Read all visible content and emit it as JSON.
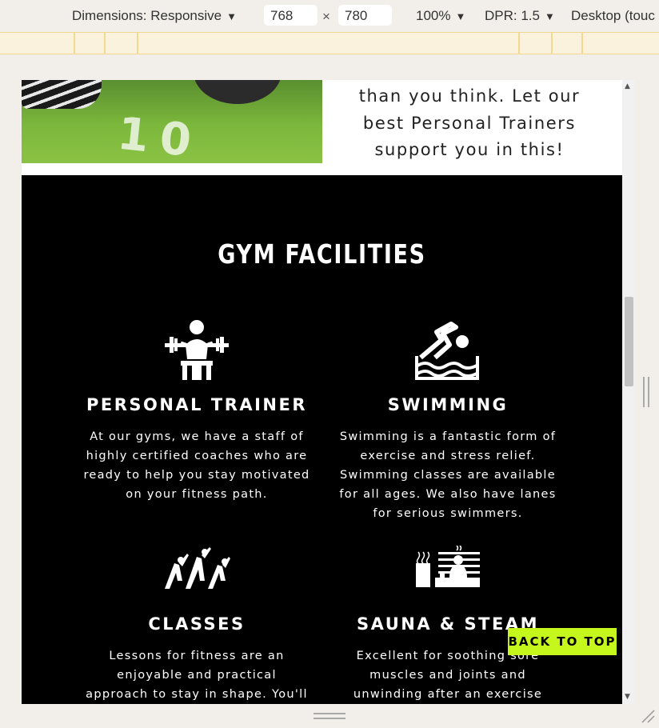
{
  "devtools": {
    "dimensions_label": "Dimensions: Responsive",
    "width_value": "768",
    "times_sign": "×",
    "height_value": "780",
    "zoom": "100%",
    "dpr": "DPR: 1.5",
    "device_mode": "Desktop (touc",
    "caret": "▼"
  },
  "about": {
    "text_line_1": "than you think. Let our",
    "text_line_2": "best Personal Trainers",
    "text_line_3": "support you in this!",
    "image_number": "10"
  },
  "facilities": {
    "title": "GYM FACILITIES",
    "items": [
      {
        "icon": "weightlifting-icon",
        "title": "PERSONAL TRAINER",
        "lines": [
          "At our gyms, we have a staff of",
          "highly certified coaches who are",
          "ready to help you stay motivated",
          "on your fitness path."
        ]
      },
      {
        "icon": "swimming-icon",
        "title": "SWIMMING",
        "lines": [
          "Swimming is a fantastic form of",
          "exercise and stress relief.",
          "Swimming classes are available",
          "for all ages. We also have lanes",
          "for serious swimmers."
        ]
      },
      {
        "icon": "group-exercise-icon",
        "title": "CLASSES",
        "lines": [
          "Lessons for fitness are an",
          "enjoyable and practical",
          "approach to stay in shape. You'll"
        ]
      },
      {
        "icon": "sauna-icon",
        "title": "SAUNA & STEAM",
        "lines": [
          "Excellent for soothing sore",
          "muscles and joints and",
          "unwinding after an exercise"
        ]
      }
    ]
  },
  "back_to_top": "BACK TO TOP",
  "colors": {
    "accent": "#c6f71c",
    "section_bg": "#000000",
    "text_light": "#ffffff"
  }
}
